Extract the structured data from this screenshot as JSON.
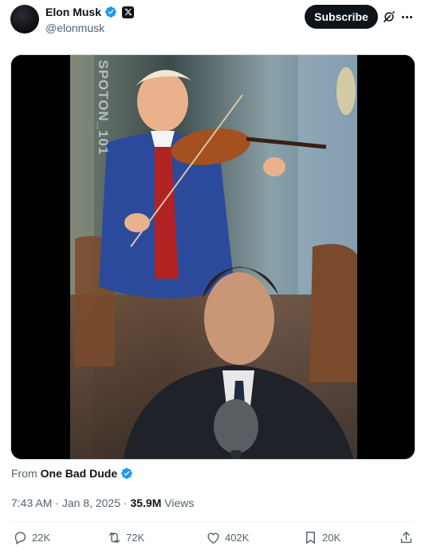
{
  "author": {
    "display_name": "Elon Musk",
    "handle": "@elonmusk",
    "verified_icon": "verified-badge-icon",
    "affiliation_icon": "x-logo-icon"
  },
  "header": {
    "subscribe_label": "Subscribe",
    "grok_icon": "grok-icon",
    "more_icon": "more-icon"
  },
  "media": {
    "watermark": "SPOTON_101"
  },
  "source": {
    "prefix": "From",
    "name": "One Bad Dude"
  },
  "meta": {
    "time": "7:43 AM",
    "separator1": " · ",
    "date": "Jan 8, 2025",
    "separator2": " · ",
    "views_count": "35.9M",
    "views_label": " Views"
  },
  "actions": {
    "replies": "22K",
    "reposts": "72K",
    "likes": "402K",
    "bookmarks": "20K"
  },
  "colors": {
    "text": "#0f1419",
    "secondary": "#536471",
    "verified": "#1d9bf0"
  }
}
